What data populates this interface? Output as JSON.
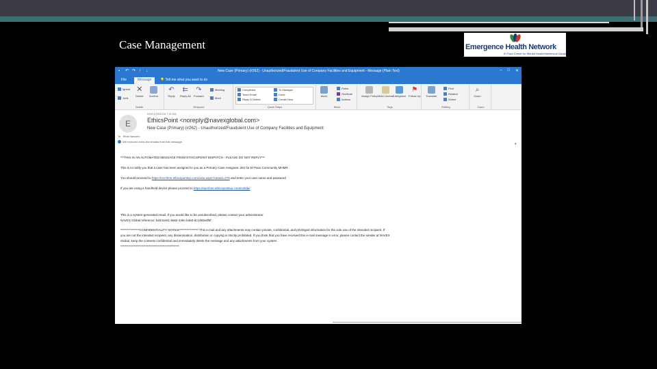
{
  "slide": {
    "title": "Case Management",
    "logo_name": "Emergence Health Network",
    "logo_tagline": "El Paso Center for Mental Health/Intellectual Disabilities"
  },
  "window": {
    "title": "New Case (Primary) (#262) - Unauthorized/Fraudulent Use of Company Facilities and Equipment  -  Message (Plain Text)"
  },
  "menubar": {
    "tabs": [
      "File",
      "Message"
    ],
    "active_tab": "Message",
    "tell_me": "Tell me what you want to do"
  },
  "ribbon": {
    "delete_group": {
      "label": "Delete",
      "ignore": "Ignore",
      "junk": "Junk",
      "delete": "Delete",
      "archive": "Archive"
    },
    "respond_group": {
      "label": "Respond",
      "reply": "Reply",
      "reply_all": "Reply All",
      "forward": "Forward",
      "meeting": "Meeting",
      "more": "More"
    },
    "quick_steps": {
      "label": "Quick Steps",
      "items": [
        "Completed",
        "Team Email",
        "Reply & Delete",
        "To Manager",
        "Done",
        "Create New"
      ]
    },
    "move_group": {
      "label": "Move",
      "move": "Move",
      "rules": "Rules",
      "onenote": "OneNote",
      "actions": "Actions"
    },
    "tags_group": {
      "label": "Tags",
      "assign_policy": "Assign Policy",
      "mark_unread": "Mark Unread",
      "categorize": "Categorize",
      "follow_up": "Follow Up"
    },
    "editing_group": {
      "label": "Editing",
      "translate": "Translate",
      "find": "Find",
      "related": "Related",
      "select": "Select"
    },
    "zoom_group": {
      "label": "Zoom",
      "zoom": "Zoom"
    }
  },
  "message": {
    "date": "Wed 4/25/2018 7:41 AM",
    "avatar_letter": "E",
    "sender": "EthicsPoint <noreply@navexglobal.com>",
    "subject": "New Case (Primary) (#262) - Unauthorized/Fraudulent Use of Company Facilities and Equipment",
    "to_label": "To",
    "to": "Rene Navarro",
    "info_bar": "We removed extra line breaks from this message.",
    "body": {
      "line1": "***THIS IS AN AUTOMATED MESSAGE FROM ETHICSPOINT DISPATCH - PLEASE DO NOT REPLY***",
      "line2": "This is to notify you that a case has been assigned to you as a Primary Case Assignee: 262 for El Paso Community MHMR",
      "line3_pre": "You should proceed to ",
      "line3_link": "https://ecmhmr.ethicspointvp.com/case.aspx?caseid=276",
      "line3_post": " and enter your user name and password",
      "line4_pre": "If you are using a handheld device please proceed to ",
      "line4_link": "https://epmhmr.ethicspointvp.com/mobile/",
      "line5": "This is a system-generated email. If you would like to be unsubscribed, please contact your administrator.",
      "line6": "NAVEX Global reference: bd441e51-8a52-448c-b4e0-dc1d83edf0f",
      "line7": "****************CONFIDENTIALITY NOTICE**************** This e-mail and any attachments may contain private, confidential, and privileged information for the sole use of the intended recipient. If",
      "line8": "you are not the intended recipient, any dissemination, distribution or copying is strictly prohibited. If you think that you have received this e-mail message in error, please contact the sender at NAVEX",
      "line9": "Global, keep the contents confidential and immediately delete the message and any attachments from your system.",
      "line10": "*************************************************"
    }
  }
}
